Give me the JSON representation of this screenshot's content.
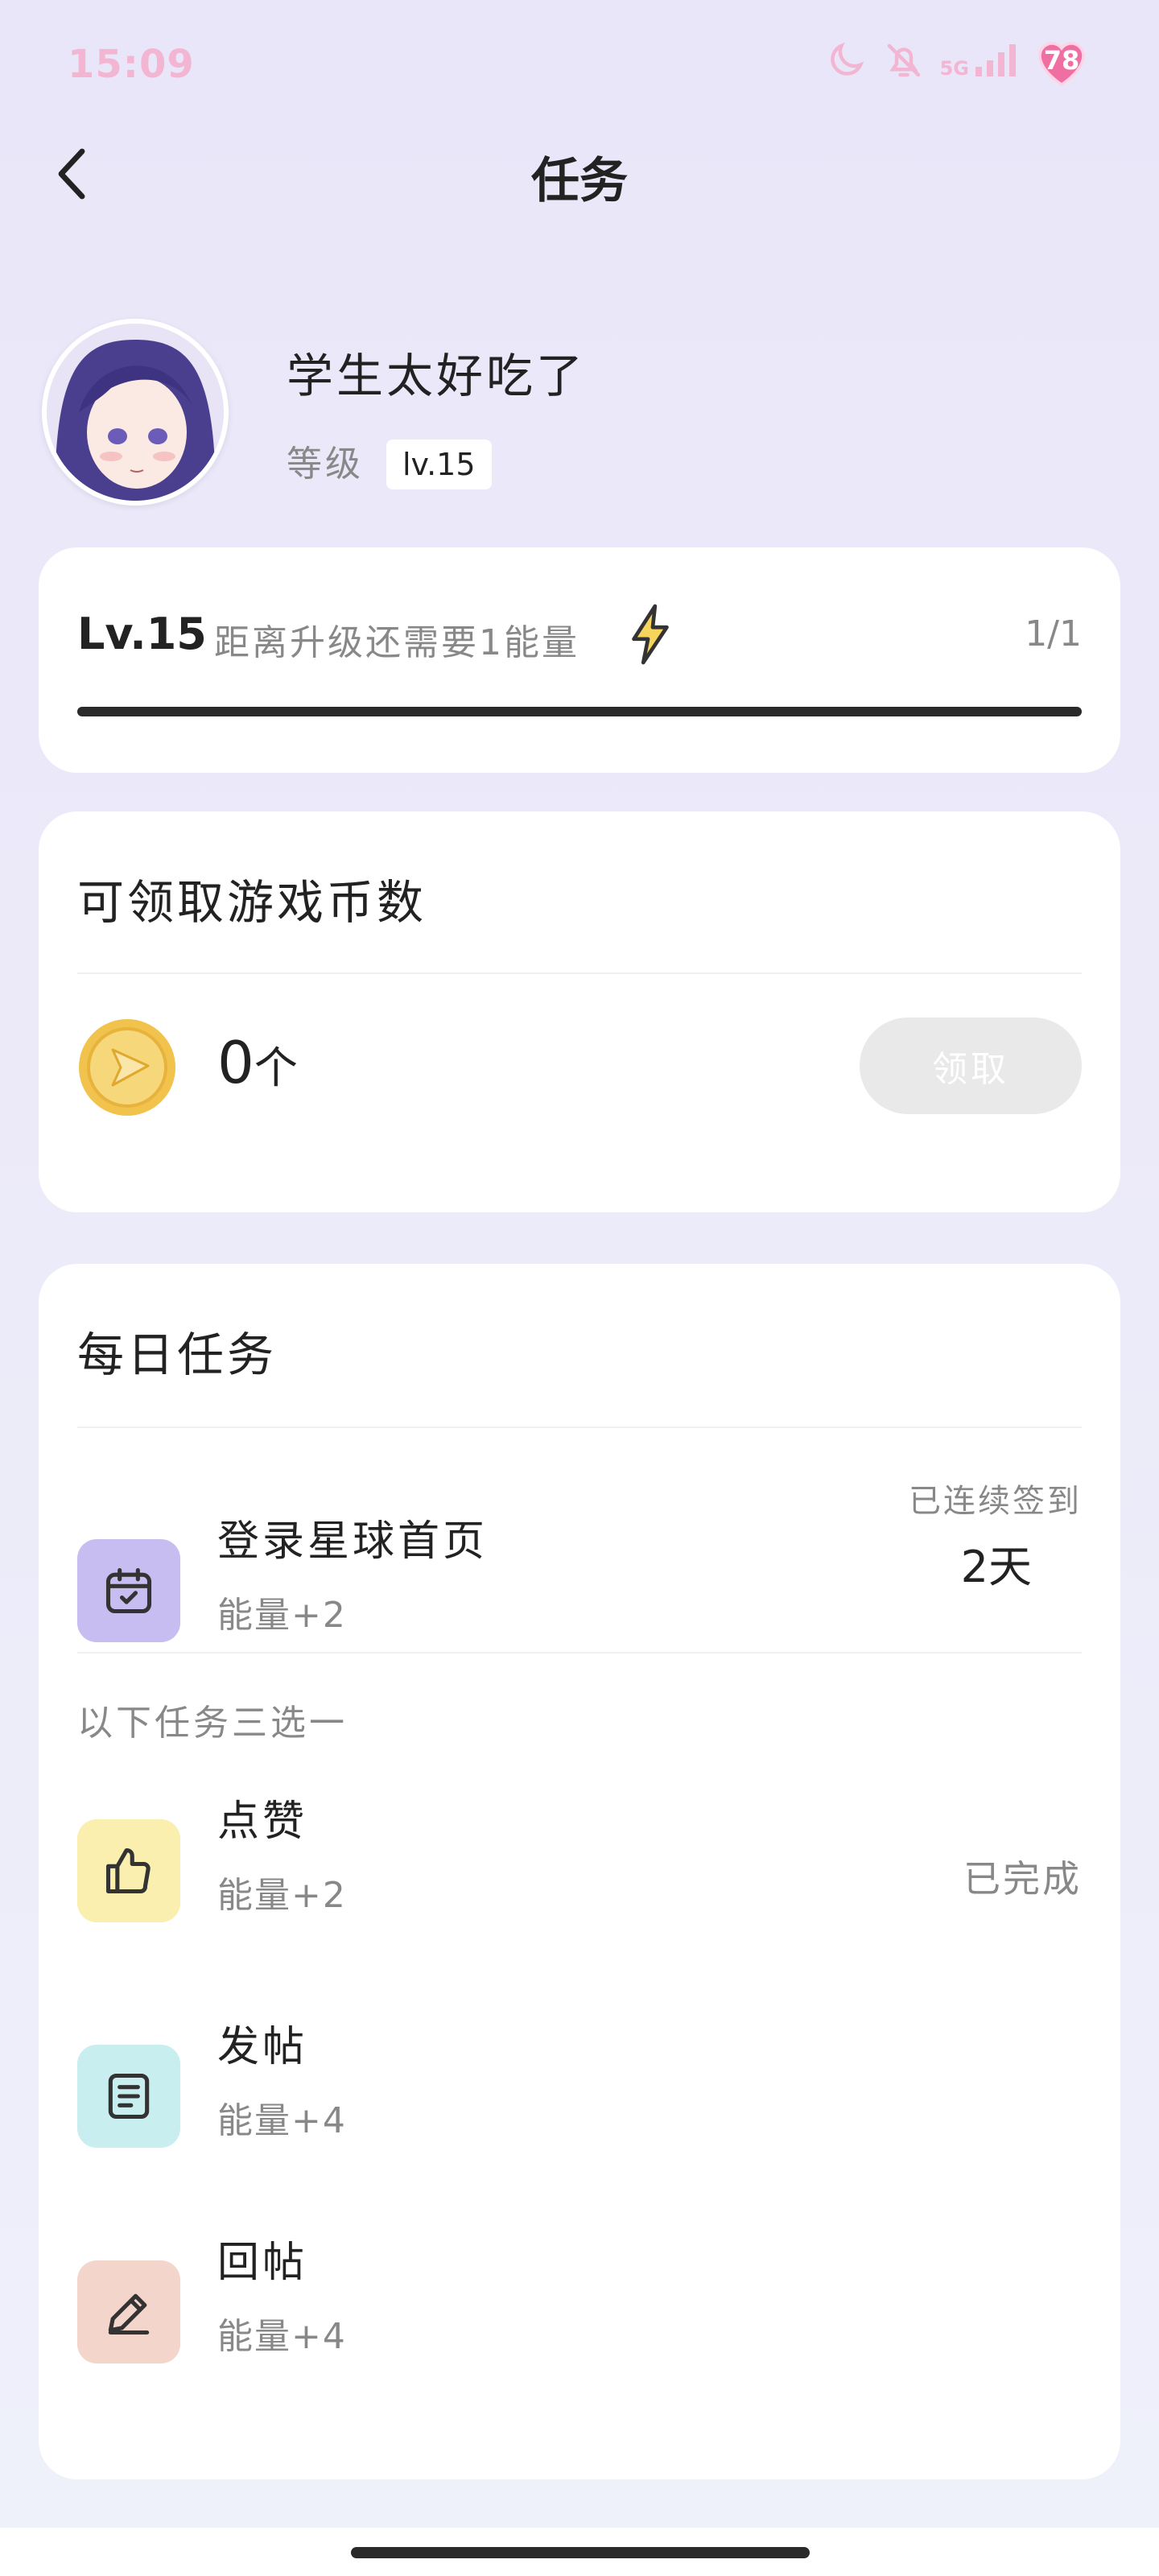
{
  "status_bar": {
    "time": "15:09",
    "network": "5G",
    "battery": "78",
    "icons": [
      "moon-icon",
      "bell-off-icon",
      "signal-icon",
      "battery-heart-icon"
    ],
    "accent": "#f3b6d2"
  },
  "header": {
    "title": "任务",
    "back_icon": "chevron-left-icon"
  },
  "profile": {
    "username": "学生太好吃了",
    "level_label": "等级",
    "level_badge": "lv.15"
  },
  "level_card": {
    "level": "Lv.15",
    "description": "距离升级还需要1能量",
    "ratio": "1/1",
    "progress": 1.0,
    "icon": "lightning-icon"
  },
  "coins_card": {
    "title": "可领取游戏币数",
    "count": "0",
    "unit": "个",
    "claim_label": "领取",
    "icon": "coin-icon"
  },
  "tasks_card": {
    "title": "每日任务",
    "daily": {
      "name": "登录星球首页",
      "energy": "能量+2",
      "streak_label": "已连续签到",
      "streak_value": "2天",
      "icon": "calendar-check-icon",
      "color": "#c7bdf0"
    },
    "choose_hint": "以下任务三选一",
    "choices": [
      {
        "name": "点赞",
        "energy": "能量+2",
        "status": "已完成",
        "icon": "thumbs-up-icon",
        "color": "#faefaf"
      },
      {
        "name": "发帖",
        "energy": "能量+4",
        "status": "",
        "icon": "document-icon",
        "color": "#c9eef0"
      },
      {
        "name": "回帖",
        "energy": "能量+4",
        "status": "",
        "icon": "pencil-icon",
        "color": "#f4d5cc"
      }
    ]
  }
}
